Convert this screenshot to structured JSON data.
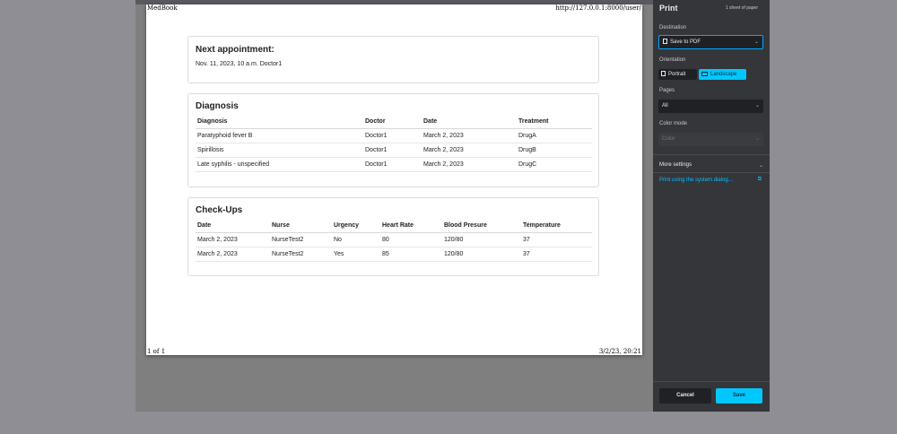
{
  "page": {
    "header_left": "MedBook",
    "header_right": "http://127.0.0.1:8000/user/",
    "footer_left": "1 of 1",
    "footer_right": "3/2/23, 20:21"
  },
  "appointment": {
    "title": "Next appointment:",
    "text": "Nov. 11, 2023, 10 a.m. Doctor1"
  },
  "diagnosis": {
    "title": "Diagnosis",
    "columns": [
      "Diagnosis",
      "Doctor",
      "Date",
      "Treatment"
    ],
    "rows": [
      [
        "Paratyphoid fever B",
        "Doctor1",
        "March 2, 2023",
        "DrugA"
      ],
      [
        "Spirillosis",
        "Doctor1",
        "March 2, 2023",
        "DrugB"
      ],
      [
        "Late syphilis - unspecified",
        "Doctor1",
        "March 2, 2023",
        "DrugC"
      ]
    ]
  },
  "checkups": {
    "title": "Check-Ups",
    "columns": [
      "Date",
      "Nurse",
      "Urgency",
      "Heart Rate",
      "Blood Presure",
      "Temperature"
    ],
    "rows": [
      [
        "March 2, 2023",
        "NurseTest2",
        "No",
        "80",
        "120/80",
        "37"
      ],
      [
        "March 2, 2023",
        "NurseTest2",
        "Yes",
        "85",
        "120/80",
        "37"
      ]
    ]
  },
  "print_panel": {
    "title": "Print",
    "sheets": "1 sheet of paper",
    "destination_label": "Destination",
    "destination_value": "Save to PDF",
    "orientation_label": "Orientation",
    "portrait": "Portrait",
    "landscape": "Landscape",
    "pages_label": "Pages",
    "pages_value": "All",
    "color_label": "Color mode",
    "color_value": "Color",
    "more_settings": "More settings",
    "system_dialog": "Print using the system dialog…",
    "cancel": "Cancel",
    "save": "Save",
    "accent_color": "#00c8ff"
  }
}
